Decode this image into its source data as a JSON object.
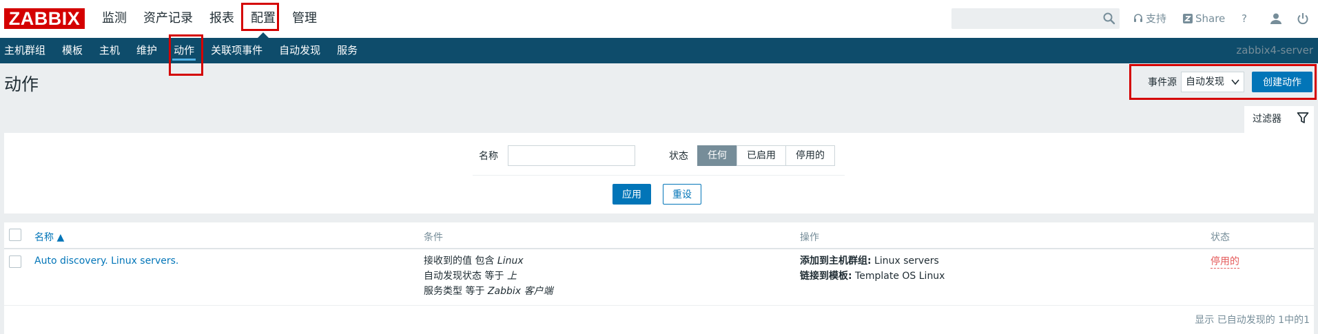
{
  "logo": "ZABBIX",
  "main_menu": [
    "监测",
    "资产记录",
    "报表",
    "配置",
    "管理"
  ],
  "search": {
    "placeholder": ""
  },
  "top_right": {
    "support": "支持",
    "share": "Share",
    "help": "?"
  },
  "sub_menu": [
    "主机群组",
    "模板",
    "主机",
    "维护",
    "动作",
    "关联项事件",
    "自动发现",
    "服务"
  ],
  "server_name": "zabbix4-server",
  "page": {
    "title": "动作",
    "event_source_label": "事件源",
    "event_source_value": "自动发现",
    "create_button": "创建动作"
  },
  "filter": {
    "tab_label": "过滤器",
    "name_label": "名称",
    "name_value": "",
    "state_label": "状态",
    "state_options": [
      "任何",
      "已启用",
      "停用的"
    ],
    "state_selected": "任何",
    "apply": "应用",
    "reset": "重设"
  },
  "table": {
    "headers": {
      "name": "名称 ▲",
      "conditions": "条件",
      "operations": "操作",
      "status": "状态"
    },
    "rows": [
      {
        "name": "Auto discovery. Linux servers.",
        "conditions": [
          {
            "text": "接收到的值 包含 ",
            "value": "Linux"
          },
          {
            "text": "自动发现状态 等于 ",
            "value": "上"
          },
          {
            "text": "服务类型 等于 ",
            "value": "Zabbix 客户端"
          }
        ],
        "operations": [
          {
            "label": "添加到主机群组:",
            "value": " Linux servers"
          },
          {
            "label": "链接到模板:",
            "value": " Template OS Linux"
          }
        ],
        "status": "停用的"
      }
    ],
    "footer": "显示 已自动发现的 1中的1"
  },
  "colors": {
    "brand_red": "#d40000",
    "submenu_bg": "#0e4c6b",
    "link_blue": "#0275b8",
    "disabled_red": "#e45959"
  }
}
